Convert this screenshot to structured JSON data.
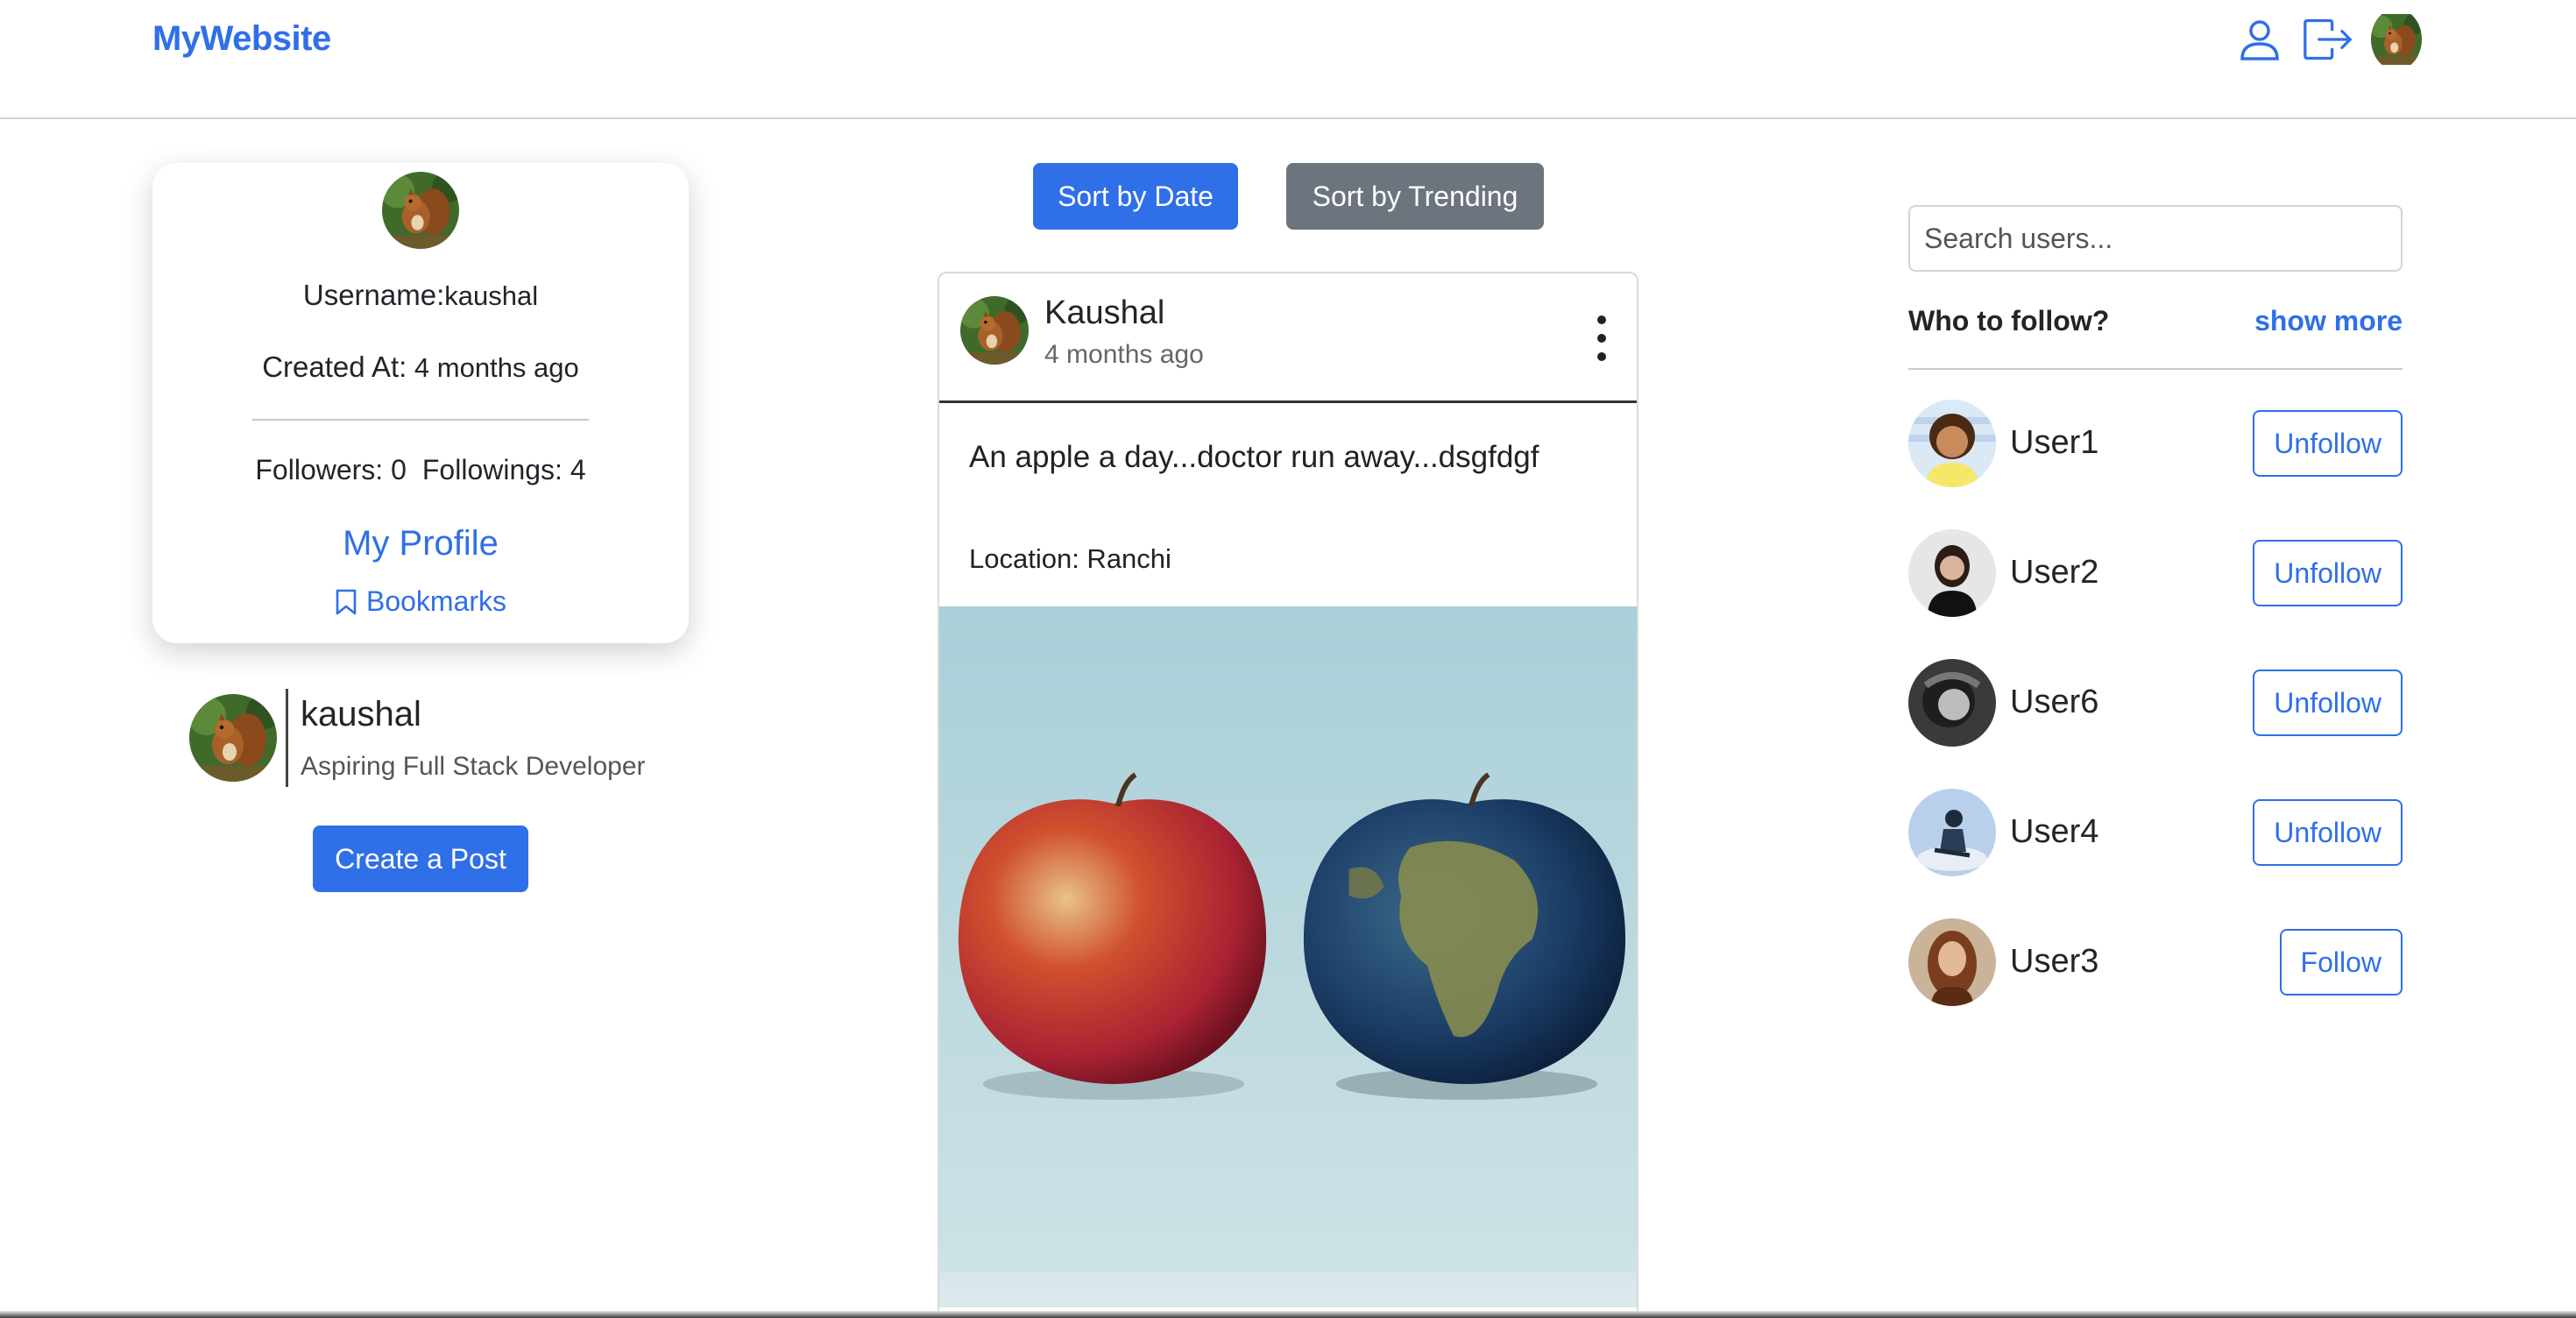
{
  "header": {
    "brand": "MyWebsite",
    "icons": [
      "user-icon",
      "logout-icon",
      "avatar"
    ]
  },
  "profile": {
    "username_label": "Username:",
    "username": "kaushal",
    "created_label": "Created At:",
    "created_value": " 4 months ago",
    "followers": "Followers: 0",
    "followings": "Followings: 4",
    "my_profile": "My Profile",
    "bookmarks": "Bookmarks"
  },
  "bio": {
    "name": "kaushal",
    "description": "Aspiring Full Stack Developer"
  },
  "actions": {
    "create_post": "Create a Post",
    "sort_date": "Sort by Date",
    "sort_trending": "Sort by Trending"
  },
  "post": {
    "author": "Kaushal",
    "time": "4 months ago",
    "text": "An apple a day...doctor run away...dsgfdgf",
    "location": "Location: Ranchi"
  },
  "sidebar": {
    "search_placeholder": "Search users...",
    "who_to_follow": "Who to follow?",
    "show_more": "show more",
    "users": [
      {
        "name": "User1",
        "action": "Unfollow"
      },
      {
        "name": "User2",
        "action": "Unfollow"
      },
      {
        "name": "User6",
        "action": "Unfollow"
      },
      {
        "name": "User4",
        "action": "Unfollow"
      },
      {
        "name": "User3",
        "action": "Follow"
      }
    ]
  },
  "colors": {
    "primary": "#2f6fe8",
    "secondary": "#6c757d"
  }
}
